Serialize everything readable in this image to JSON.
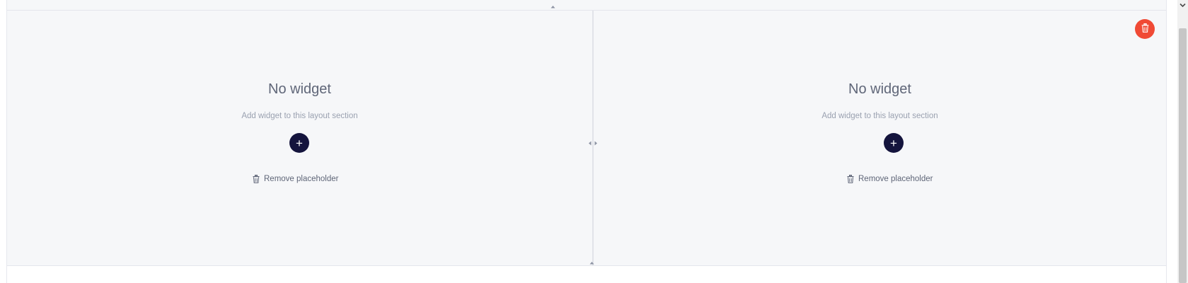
{
  "layout": {
    "sections": [
      {
        "empty_title": "No widget",
        "empty_subtitle": "Add widget to this layout section",
        "add_label": "+",
        "remove_label": "Remove placeholder"
      },
      {
        "empty_title": "No widget",
        "empty_subtitle": "Add widget to this layout section",
        "add_label": "+",
        "remove_label": "Remove placeholder"
      }
    ]
  },
  "colors": {
    "add_button": "#14143d",
    "delete_button": "#f04a35",
    "canvas_background": "#f6f7f9",
    "muted_text": "#9aa1b0",
    "body_text": "#5f6678"
  },
  "icons": {
    "add": "plus-icon",
    "remove": "trash-icon",
    "delete_row": "trash-icon",
    "resize_vertical": "resize-vertical-icon",
    "resize_horizontal": "resize-horizontal-icon",
    "scroll": "chevron-down-icon"
  }
}
